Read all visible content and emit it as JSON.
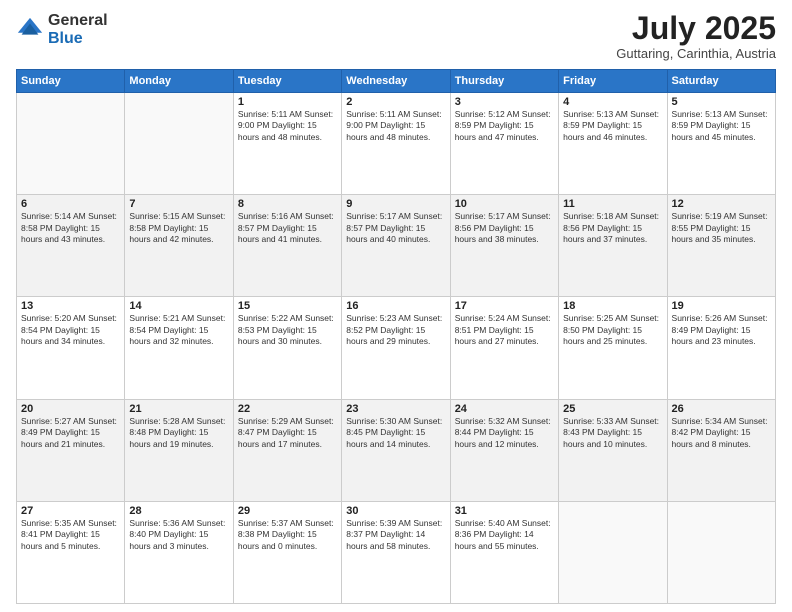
{
  "logo": {
    "general": "General",
    "blue": "Blue"
  },
  "title": "July 2025",
  "location": "Guttaring, Carinthia, Austria",
  "days_of_week": [
    "Sunday",
    "Monday",
    "Tuesday",
    "Wednesday",
    "Thursday",
    "Friday",
    "Saturday"
  ],
  "weeks": [
    [
      {
        "day": "",
        "info": ""
      },
      {
        "day": "",
        "info": ""
      },
      {
        "day": "1",
        "info": "Sunrise: 5:11 AM\nSunset: 9:00 PM\nDaylight: 15 hours\nand 48 minutes."
      },
      {
        "day": "2",
        "info": "Sunrise: 5:11 AM\nSunset: 9:00 PM\nDaylight: 15 hours\nand 48 minutes."
      },
      {
        "day": "3",
        "info": "Sunrise: 5:12 AM\nSunset: 8:59 PM\nDaylight: 15 hours\nand 47 minutes."
      },
      {
        "day": "4",
        "info": "Sunrise: 5:13 AM\nSunset: 8:59 PM\nDaylight: 15 hours\nand 46 minutes."
      },
      {
        "day": "5",
        "info": "Sunrise: 5:13 AM\nSunset: 8:59 PM\nDaylight: 15 hours\nand 45 minutes."
      }
    ],
    [
      {
        "day": "6",
        "info": "Sunrise: 5:14 AM\nSunset: 8:58 PM\nDaylight: 15 hours\nand 43 minutes."
      },
      {
        "day": "7",
        "info": "Sunrise: 5:15 AM\nSunset: 8:58 PM\nDaylight: 15 hours\nand 42 minutes."
      },
      {
        "day": "8",
        "info": "Sunrise: 5:16 AM\nSunset: 8:57 PM\nDaylight: 15 hours\nand 41 minutes."
      },
      {
        "day": "9",
        "info": "Sunrise: 5:17 AM\nSunset: 8:57 PM\nDaylight: 15 hours\nand 40 minutes."
      },
      {
        "day": "10",
        "info": "Sunrise: 5:17 AM\nSunset: 8:56 PM\nDaylight: 15 hours\nand 38 minutes."
      },
      {
        "day": "11",
        "info": "Sunrise: 5:18 AM\nSunset: 8:56 PM\nDaylight: 15 hours\nand 37 minutes."
      },
      {
        "day": "12",
        "info": "Sunrise: 5:19 AM\nSunset: 8:55 PM\nDaylight: 15 hours\nand 35 minutes."
      }
    ],
    [
      {
        "day": "13",
        "info": "Sunrise: 5:20 AM\nSunset: 8:54 PM\nDaylight: 15 hours\nand 34 minutes."
      },
      {
        "day": "14",
        "info": "Sunrise: 5:21 AM\nSunset: 8:54 PM\nDaylight: 15 hours\nand 32 minutes."
      },
      {
        "day": "15",
        "info": "Sunrise: 5:22 AM\nSunset: 8:53 PM\nDaylight: 15 hours\nand 30 minutes."
      },
      {
        "day": "16",
        "info": "Sunrise: 5:23 AM\nSunset: 8:52 PM\nDaylight: 15 hours\nand 29 minutes."
      },
      {
        "day": "17",
        "info": "Sunrise: 5:24 AM\nSunset: 8:51 PM\nDaylight: 15 hours\nand 27 minutes."
      },
      {
        "day": "18",
        "info": "Sunrise: 5:25 AM\nSunset: 8:50 PM\nDaylight: 15 hours\nand 25 minutes."
      },
      {
        "day": "19",
        "info": "Sunrise: 5:26 AM\nSunset: 8:49 PM\nDaylight: 15 hours\nand 23 minutes."
      }
    ],
    [
      {
        "day": "20",
        "info": "Sunrise: 5:27 AM\nSunset: 8:49 PM\nDaylight: 15 hours\nand 21 minutes."
      },
      {
        "day": "21",
        "info": "Sunrise: 5:28 AM\nSunset: 8:48 PM\nDaylight: 15 hours\nand 19 minutes."
      },
      {
        "day": "22",
        "info": "Sunrise: 5:29 AM\nSunset: 8:47 PM\nDaylight: 15 hours\nand 17 minutes."
      },
      {
        "day": "23",
        "info": "Sunrise: 5:30 AM\nSunset: 8:45 PM\nDaylight: 15 hours\nand 14 minutes."
      },
      {
        "day": "24",
        "info": "Sunrise: 5:32 AM\nSunset: 8:44 PM\nDaylight: 15 hours\nand 12 minutes."
      },
      {
        "day": "25",
        "info": "Sunrise: 5:33 AM\nSunset: 8:43 PM\nDaylight: 15 hours\nand 10 minutes."
      },
      {
        "day": "26",
        "info": "Sunrise: 5:34 AM\nSunset: 8:42 PM\nDaylight: 15 hours\nand 8 minutes."
      }
    ],
    [
      {
        "day": "27",
        "info": "Sunrise: 5:35 AM\nSunset: 8:41 PM\nDaylight: 15 hours\nand 5 minutes."
      },
      {
        "day": "28",
        "info": "Sunrise: 5:36 AM\nSunset: 8:40 PM\nDaylight: 15 hours\nand 3 minutes."
      },
      {
        "day": "29",
        "info": "Sunrise: 5:37 AM\nSunset: 8:38 PM\nDaylight: 15 hours\nand 0 minutes."
      },
      {
        "day": "30",
        "info": "Sunrise: 5:39 AM\nSunset: 8:37 PM\nDaylight: 14 hours\nand 58 minutes."
      },
      {
        "day": "31",
        "info": "Sunrise: 5:40 AM\nSunset: 8:36 PM\nDaylight: 14 hours\nand 55 minutes."
      },
      {
        "day": "",
        "info": ""
      },
      {
        "day": "",
        "info": ""
      }
    ]
  ]
}
